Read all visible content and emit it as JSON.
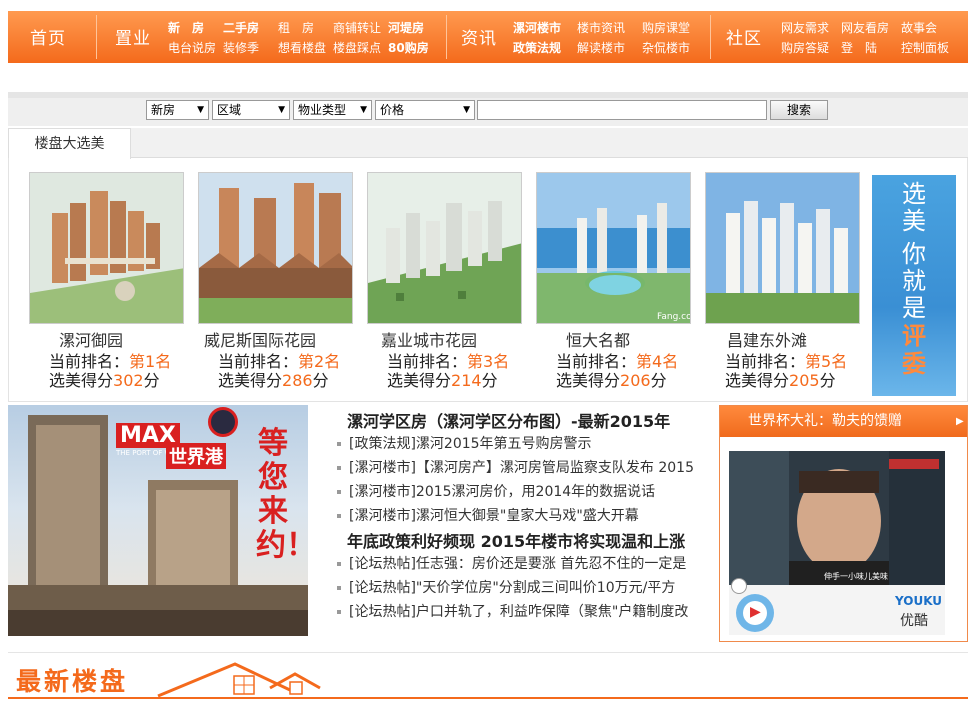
{
  "nav": {
    "home": "首页",
    "property": "置业",
    "news": "资讯",
    "community": "社区",
    "links_property": [
      {
        "label": "新　房",
        "bold": true
      },
      {
        "label": "二手房",
        "bold": true
      },
      {
        "label": "电台说房",
        "bold": false
      },
      {
        "label": "装修季",
        "bold": false
      },
      {
        "label": "租　房",
        "bold": false
      },
      {
        "label": "商铺转让",
        "bold": false
      },
      {
        "label": "河堤房",
        "bold": true
      },
      {
        "label": "想看楼盘",
        "bold": false
      },
      {
        "label": "楼盘踩点",
        "bold": false
      },
      {
        "label": "80购房",
        "bold": true
      }
    ],
    "links_news": [
      {
        "label": "漯河楼市",
        "bold": true
      },
      {
        "label": "楼市资讯",
        "bold": false
      },
      {
        "label": "购房课堂",
        "bold": false
      },
      {
        "label": "政策法规",
        "bold": true
      },
      {
        "label": "解读楼市",
        "bold": false
      },
      {
        "label": "杂侃楼市",
        "bold": false
      }
    ],
    "links_community": [
      {
        "label": "网友需求"
      },
      {
        "label": "网友看房"
      },
      {
        "label": "故事会"
      },
      {
        "label": "购房答疑"
      },
      {
        "label": "登　陆"
      },
      {
        "label": "控制面板"
      }
    ]
  },
  "search": {
    "type": "新房",
    "area": "区域",
    "ptype": "物业类型",
    "price": "价格",
    "button": "搜索"
  },
  "selection": {
    "tab": "楼盘大选美",
    "rank_label": "当前排名：",
    "score_label": "选美得分",
    "score_unit": "分",
    "buildings": [
      {
        "name": "漯河御园",
        "rank": "第1名",
        "score": "302"
      },
      {
        "name": "威尼斯国际花园",
        "rank": "第2名",
        "score": "286"
      },
      {
        "name": "嘉业城市花园",
        "rank": "第3名",
        "score": "214"
      },
      {
        "name": "恒大名都",
        "rank": "第4名",
        "score": "206"
      },
      {
        "name": "昌建东外滩",
        "rank": "第5名",
        "score": "205"
      }
    ],
    "banner": [
      "选",
      "美",
      "你",
      "就",
      "是",
      "评",
      "委"
    ],
    "image_watermark": "Fang.com"
  },
  "promo": {
    "brand": "MAX",
    "brand_cn": "世界港",
    "brand_en": "THE PORT OF WORLD",
    "tagline": "等您来约！"
  },
  "news": {
    "heads": [
      "漯河学区房（漯河学区分布图）-最新2015年",
      "年底政策利好频现 2015年楼市将实现温和上涨"
    ],
    "group1": [
      "[政策法规]漯河2015年第五号购房警示",
      "[漯河楼市]【漯河房产】漯河房管局监察支队发布 2015",
      "[漯河楼市]2015漯河房价，用2014年的数据说话",
      "[漯河楼市]漯河恒大御景\"皇家大马戏\"盛大开幕"
    ],
    "group2": [
      "[论坛热帖]任志强：房价还是要涨 首先忍不住的一定是",
      "[论坛热帖]\"天价学位房\"分割成三间叫价10万元/平方",
      "[论坛热帖]户口并轨了，利益咋保障（聚焦\"户籍制度改"
    ]
  },
  "video": {
    "title": "世界杯大礼：勒夫的馈赠",
    "logo": "YOUKU",
    "logo_cn": "优酷",
    "subtitle": "伸手一小味儿美味"
  },
  "latest": {
    "title": "最新楼盘"
  },
  "colors": {
    "accent": "#f46a1c",
    "blue_banner": "#3a8fd4"
  }
}
